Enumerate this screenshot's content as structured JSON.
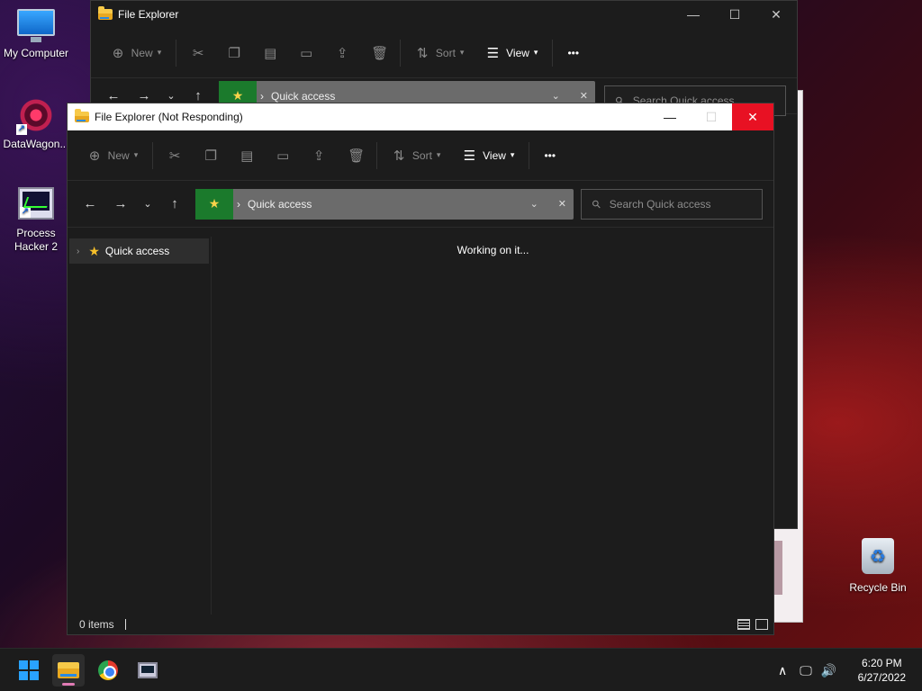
{
  "desktop": {
    "icons": [
      {
        "label": "My Computer"
      },
      {
        "label": "DataWagon..."
      },
      {
        "label": "Process\nHacker 2"
      },
      {
        "label": "Recycle Bin"
      }
    ]
  },
  "back_window": {
    "title": "File Explorer",
    "toolbar": {
      "new_label": "New",
      "sort_label": "Sort",
      "view_label": "View",
      "more_label": "•••"
    },
    "address": {
      "crumb": "Quick access"
    },
    "search": {
      "placeholder": "Search Quick access"
    }
  },
  "front_window": {
    "title": "File Explorer (Not Responding)",
    "toolbar": {
      "new_label": "New",
      "sort_label": "Sort",
      "view_label": "View",
      "more_label": "•••"
    },
    "address": {
      "crumb": "Quick access"
    },
    "search": {
      "placeholder": "Search Quick access"
    },
    "sidebar": {
      "items": [
        {
          "label": "Quick access"
        }
      ]
    },
    "content": {
      "message": "Working on it..."
    },
    "status": {
      "items_count": "0 items"
    }
  },
  "taskbar": {
    "clock": {
      "time": "6:20 PM",
      "date": "6/27/2022"
    }
  },
  "icons": {
    "start": "windows-logo-icon",
    "explorer": "folder-icon",
    "chrome": "chrome-icon",
    "process_hacker": "process-hacker-icon"
  },
  "colors": {
    "close_button": "#e81123",
    "address_star_bg": "#1b7a2c",
    "taskbar_bg": "#1c1c1c"
  }
}
